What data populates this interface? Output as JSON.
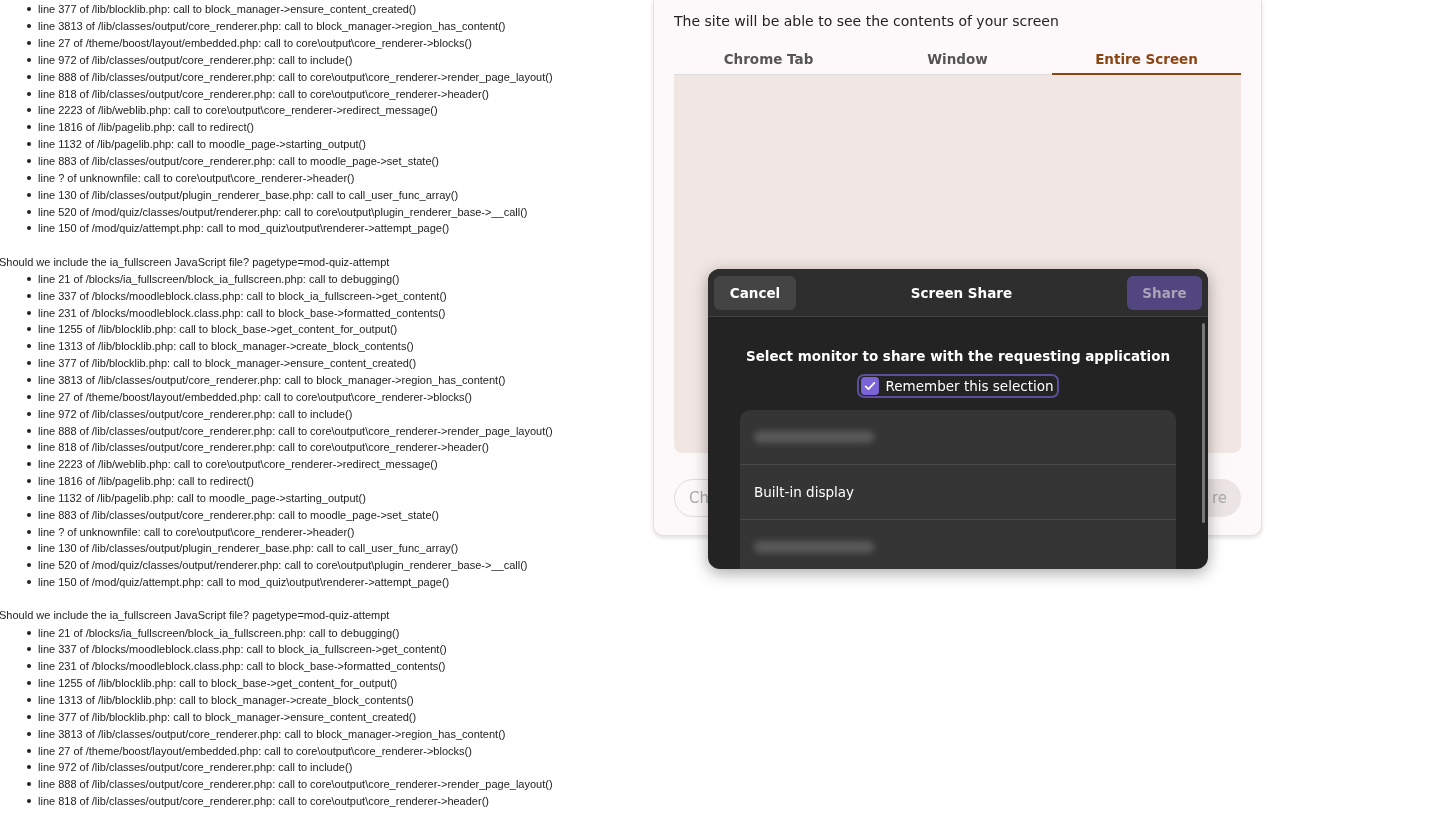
{
  "log": {
    "groups": [
      {
        "lines": [
          "line 377 of /lib/blocklib.php: call to block_manager->ensure_content_created()",
          "line 3813 of /lib/classes/output/core_renderer.php: call to block_manager->region_has_content()",
          "line 27 of /theme/boost/layout/embedded.php: call to core\\output\\core_renderer->blocks()",
          "line 972 of /lib/classes/output/core_renderer.php: call to include()",
          "line 888 of /lib/classes/output/core_renderer.php: call to core\\output\\core_renderer->render_page_layout()",
          "line 818 of /lib/classes/output/core_renderer.php: call to core\\output\\core_renderer->header()",
          "line 2223 of /lib/weblib.php: call to core\\output\\core_renderer->redirect_message()",
          "line 1816 of /lib/pagelib.php: call to redirect()",
          "line 1132 of /lib/pagelib.php: call to moodle_page->starting_output()",
          "line 883 of /lib/classes/output/core_renderer.php: call to moodle_page->set_state()",
          "line ? of unknownfile: call to core\\output\\core_renderer->header()",
          "line 130 of /lib/classes/output/plugin_renderer_base.php: call to call_user_func_array()",
          "line 520 of /mod/quiz/classes/output/renderer.php: call to core\\output\\plugin_renderer_base->__call()",
          "line 150 of /mod/quiz/attempt.php: call to mod_quiz\\output\\renderer->attempt_page()"
        ]
      },
      {
        "heading": "Should we include the ia_fullscreen JavaScript file? pagetype=mod-quiz-attempt",
        "lines": [
          "line 21 of /blocks/ia_fullscreen/block_ia_fullscreen.php: call to debugging()",
          "line 337 of /blocks/moodleblock.class.php: call to block_ia_fullscreen->get_content()",
          "line 231 of /blocks/moodleblock.class.php: call to block_base->formatted_contents()",
          "line 1255 of /lib/blocklib.php: call to block_base->get_content_for_output()",
          "line 1313 of /lib/blocklib.php: call to block_manager->create_block_contents()",
          "line 377 of /lib/blocklib.php: call to block_manager->ensure_content_created()",
          "line 3813 of /lib/classes/output/core_renderer.php: call to block_manager->region_has_content()",
          "line 27 of /theme/boost/layout/embedded.php: call to core\\output\\core_renderer->blocks()",
          "line 972 of /lib/classes/output/core_renderer.php: call to include()",
          "line 888 of /lib/classes/output/core_renderer.php: call to core\\output\\core_renderer->render_page_layout()",
          "line 818 of /lib/classes/output/core_renderer.php: call to core\\output\\core_renderer->header()",
          "line 2223 of /lib/weblib.php: call to core\\output\\core_renderer->redirect_message()",
          "line 1816 of /lib/pagelib.php: call to redirect()",
          "line 1132 of /lib/pagelib.php: call to moodle_page->starting_output()",
          "line 883 of /lib/classes/output/core_renderer.php: call to moodle_page->set_state()",
          "line ? of unknownfile: call to core\\output\\core_renderer->header()",
          "line 130 of /lib/classes/output/plugin_renderer_base.php: call to call_user_func_array()",
          "line 520 of /mod/quiz/classes/output/renderer.php: call to core\\output\\plugin_renderer_base->__call()",
          "line 150 of /mod/quiz/attempt.php: call to mod_quiz\\output\\renderer->attempt_page()"
        ]
      },
      {
        "heading": "Should we include the ia_fullscreen JavaScript file? pagetype=mod-quiz-attempt",
        "lines": [
          "line 21 of /blocks/ia_fullscreen/block_ia_fullscreen.php: call to debugging()",
          "line 337 of /blocks/moodleblock.class.php: call to block_ia_fullscreen->get_content()",
          "line 231 of /blocks/moodleblock.class.php: call to block_base->formatted_contents()",
          "line 1255 of /lib/blocklib.php: call to block_base->get_content_for_output()",
          "line 1313 of /lib/blocklib.php: call to block_manager->create_block_contents()",
          "line 377 of /lib/blocklib.php: call to block_manager->ensure_content_created()",
          "line 3813 of /lib/classes/output/core_renderer.php: call to block_manager->region_has_content()",
          "line 27 of /theme/boost/layout/embedded.php: call to core\\output\\core_renderer->blocks()",
          "line 972 of /lib/classes/output/core_renderer.php: call to include()",
          "line 888 of /lib/classes/output/core_renderer.php: call to core\\output\\core_renderer->render_page_layout()",
          "line 818 of /lib/classes/output/core_renderer.php: call to core\\output\\core_renderer->header()"
        ]
      }
    ]
  },
  "share_picker": {
    "subtitle": "The site will be able to see the contents of your screen",
    "tabs": [
      {
        "label": "Chrome Tab",
        "selected": false
      },
      {
        "label": "Window",
        "selected": false
      },
      {
        "label": "Entire Screen",
        "selected": true
      }
    ],
    "buttons": [
      "Ch",
      "re"
    ]
  },
  "portal_dialog": {
    "cancel": "Cancel",
    "title": "Screen Share",
    "share": "Share",
    "prompt": "Select monitor to share with the requesting application",
    "remember": {
      "label": "Remember this selection",
      "checked": true
    },
    "monitors": [
      {
        "kind": "blurred"
      },
      {
        "kind": "named",
        "label": "Built-in display"
      },
      {
        "kind": "blurred"
      }
    ]
  }
}
